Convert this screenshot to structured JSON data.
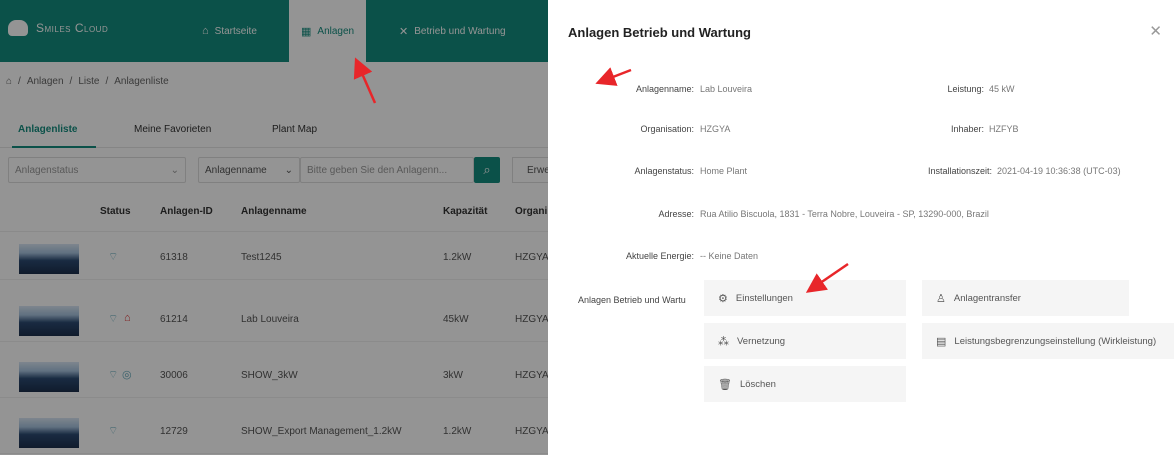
{
  "app": {
    "brand": "Smiles Cloud",
    "nav": [
      {
        "label": "Startseite",
        "icon": "home-icon",
        "active": false
      },
      {
        "label": "Anlagen",
        "icon": "grid-icon",
        "active": true
      },
      {
        "label": "Betrieb und Wartung",
        "icon": "tools-icon",
        "active": false
      }
    ],
    "breadcrumb": [
      "Anlagen",
      "Liste",
      "Anlagenliste"
    ],
    "tabs": [
      "Anlagenliste",
      "Meine Favorieten",
      "Plant Map"
    ],
    "filters": {
      "status_placeholder": "Anlagenstatus",
      "field_select": "Anlagenname",
      "search_placeholder": "Bitte geben Sie den Anlagenn...",
      "extend_label": "Erwei"
    },
    "table": {
      "headers": [
        "Status",
        "Anlagen-ID",
        "Anlagenname",
        "Kapazität",
        "Organi"
      ],
      "rows": [
        {
          "id": "61318",
          "name": "Test1245",
          "capacity": "1.2kW",
          "org": "HZGYA"
        },
        {
          "id": "61214",
          "name": "Lab Louveira",
          "capacity": "45kW",
          "org": "HZGYA"
        },
        {
          "id": "30006",
          "name": "SHOW_3kW",
          "capacity": "3kW",
          "org": "HZGYA"
        },
        {
          "id": "12729",
          "name": "SHOW_Export Management_1.2kW",
          "capacity": "1.2kW",
          "org": "HZGYA"
        }
      ]
    }
  },
  "drawer": {
    "title": "Anlagen Betrieb und Wartung",
    "fields": {
      "name_label": "Anlagenname:",
      "name_value": "Lab Louveira",
      "power_label": "Leistung:",
      "power_value": "45 kW",
      "org_label": "Organisation:",
      "org_value": "HZGYA",
      "owner_label": "Inhaber:",
      "owner_value": "HZFYB",
      "status_label": "Anlagenstatus:",
      "status_value": "Home Plant",
      "install_label": "Installationszeit:",
      "install_value": "2021-04-19 10:36:38 (UTC-03)",
      "address_label": "Adresse:",
      "address_value": "Rua Atilio Biscuola, 1831 - Terra Nobre, Louveira - SP, 13290-000, Brazil",
      "energy_label": "Aktuelle Energie:",
      "energy_value": "-- Keine Daten",
      "actions_label": "Anlagen Betrieb und Wartu"
    },
    "actions": [
      {
        "label": "Einstellungen",
        "icon": "gear-icon"
      },
      {
        "label": "Anlagentransfer",
        "icon": "user-icon"
      },
      {
        "label": "Vernetzung",
        "icon": "network-icon"
      },
      {
        "label": "Leistungsbegrenzungseinstellung (Wirkleistung)",
        "icon": "calendar-icon"
      },
      {
        "label": "Löschen",
        "icon": "trash-icon"
      }
    ]
  }
}
